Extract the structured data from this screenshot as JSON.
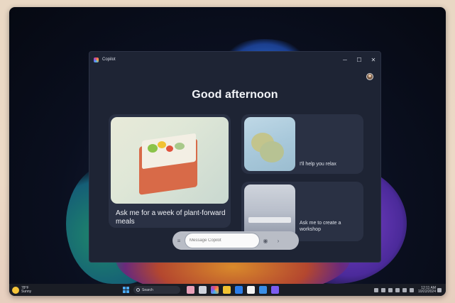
{
  "window": {
    "title": "Copilot",
    "controls": {
      "minimize": "─",
      "maximize": "☐",
      "close": "✕"
    }
  },
  "greeting": "Good afternoon",
  "cards": {
    "meals": "Ask me for a week of plant-forward meals",
    "relax": "I'll help you relax",
    "workshop": "Ask me to create a workshop"
  },
  "composer": {
    "placeholder": "Message Copilot",
    "left_icon": "≡",
    "right_icon": "◉"
  },
  "taskbar": {
    "weather_temp": "78°F",
    "weather_desc": "Sunny",
    "search_label": "Search",
    "time": "12:11 AM",
    "date": "10/22/2024"
  },
  "colors": {
    "window_bg": "#1e2434",
    "card_bg": "#2a3144",
    "accent": "#4aa8f0"
  }
}
